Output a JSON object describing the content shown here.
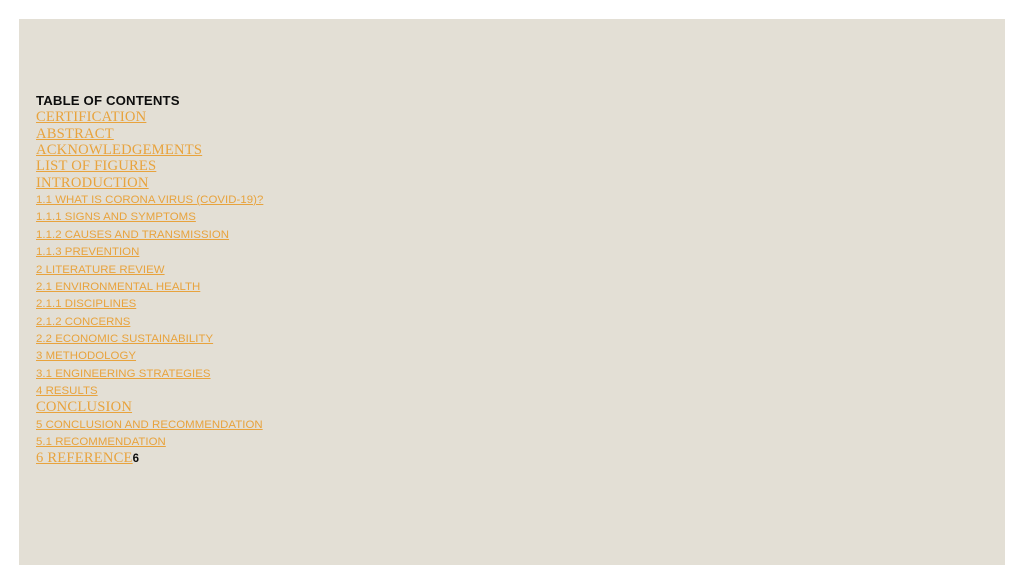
{
  "slide": {
    "background_color": "#e3dfd5",
    "canvas_color": "#ffffff",
    "link_color": "#e8a33d",
    "text_color": "#0d0d0d",
    "heading": "TABLE OF CONTENTS",
    "trailing_page_number": "6"
  },
  "toc": {
    "items": [
      {
        "label": "CERTIFICATION",
        "style": "serif"
      },
      {
        "label": "ABSTRACT",
        "style": "serif"
      },
      {
        "label": "ACKNOWLEDGEMENTS",
        "style": "serif"
      },
      {
        "label": "LIST OF FIGURES",
        "style": "serif"
      },
      {
        "label": "INTRODUCTION",
        "style": "serif"
      },
      {
        "label": "1.1 WHAT IS CORONA VIRUS (COVID-19)?",
        "style": "sans"
      },
      {
        "label": "1.1.1 SIGNS AND SYMPTOMS",
        "style": "sans"
      },
      {
        "label": "1.1.2 CAUSES AND TRANSMISSION",
        "style": "sans"
      },
      {
        "label": "1.1.3 PREVENTION",
        "style": "sans"
      },
      {
        "label": "2 LITERATURE REVIEW",
        "style": "sans"
      },
      {
        "label": "2.1 ENVIRONMENTAL HEALTH",
        "style": "sans"
      },
      {
        "label": "2.1.1 DISCIPLINES",
        "style": "sans"
      },
      {
        "label": "2.1.2 CONCERNS",
        "style": "sans"
      },
      {
        "label": "2.2 ECONOMIC SUSTAINABILITY",
        "style": "sans"
      },
      {
        "label": "3 METHODOLOGY",
        "style": "sans"
      },
      {
        "label": "3.1 ENGINEERING STRATEGIES",
        "style": "sans"
      },
      {
        "label": "4 RESULTS",
        "style": "sans"
      },
      {
        "label": "CONCLUSION",
        "style": "serif"
      },
      {
        "label": "5 CONCLUSION AND RECOMMENDATION",
        "style": "sans"
      },
      {
        "label": "5.1 RECOMMENDATION",
        "style": "sans"
      },
      {
        "label": "6 REFERENCE",
        "style": "serif"
      }
    ]
  }
}
